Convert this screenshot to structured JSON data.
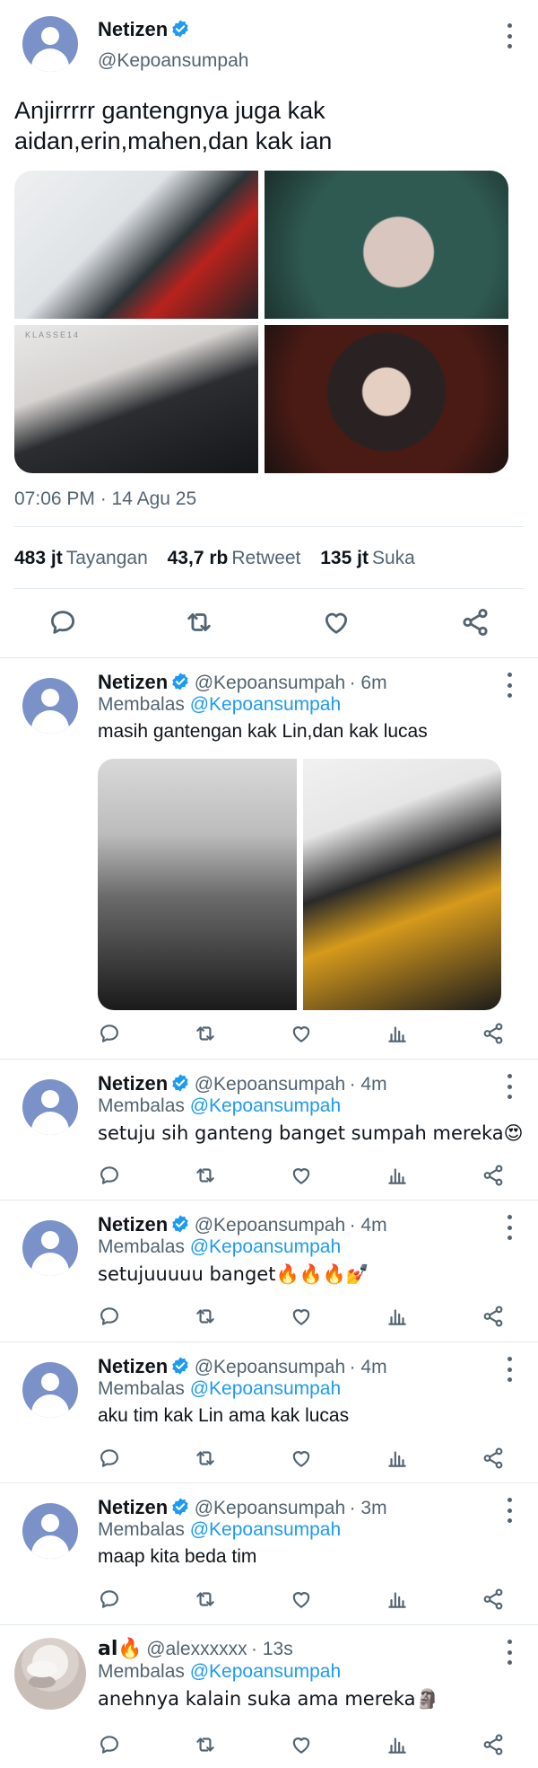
{
  "main_tweet": {
    "author": {
      "name": "Netizen",
      "handle": "@Kepoansumpah",
      "verified": true
    },
    "text": "Anjirrrrr gantengnya juga kak aidan,erin,mahen,dan kak ian",
    "media_count": 4,
    "media_caption": "KLASSE14",
    "timestamp": "07:06 PM · 14 Agu 25",
    "stats": {
      "views_value": "483 jt",
      "views_label": "Tayangan",
      "retweets_value": "43,7 rb",
      "retweets_label": "Retweet",
      "likes_value": "135 jt",
      "likes_label": "Suka"
    },
    "actions": [
      "reply-icon",
      "retweet-icon",
      "like-icon",
      "share-icon"
    ]
  },
  "replies": [
    {
      "name": "Netizen",
      "handle": "@Kepoansumpah",
      "time": "· 6m",
      "verified": true,
      "replying_prefix": "Membalas",
      "replying_to": "@Kepoansumpah",
      "text": "masih gantengan kak Lin,dan kak lucas",
      "has_media": true
    },
    {
      "name": "Netizen",
      "handle": "@Kepoansumpah",
      "time": "· 4m",
      "verified": true,
      "replying_prefix": "Membalas",
      "replying_to": "@Kepoansumpah",
      "text": "setuju sih ganteng banget sumpah mereka😍"
    },
    {
      "name": "Netizen",
      "handle": "@Kepoansumpah",
      "time": "· 4m",
      "verified": true,
      "replying_prefix": "Membalas",
      "replying_to": "@Kepoansumpah",
      "text": "setujuuuuu banget🔥🔥🔥💅"
    },
    {
      "name": "Netizen",
      "handle": "@Kepoansumpah",
      "time": "· 4m",
      "verified": true,
      "replying_prefix": "Membalas",
      "replying_to": "@Kepoansumpah",
      "text": "aku tim kak Lin ama kak lucas"
    },
    {
      "name": "Netizen",
      "handle": "@Kepoansumpah",
      "time": "· 3m",
      "verified": true,
      "replying_prefix": "Membalas",
      "replying_to": "@Kepoansumpah",
      "text": "maap kita beda tim"
    },
    {
      "name": "al🔥",
      "handle": "@alexxxxxx",
      "time": "· 13s",
      "verified": false,
      "replying_prefix": "Membalas",
      "replying_to": "@Kepoansumpah",
      "text": "anehnya kalain suka ama mereka🗿"
    }
  ],
  "reply_actions": [
    "reply-icon",
    "retweet-icon",
    "like-icon",
    "views-icon",
    "share-icon"
  ],
  "colors": {
    "accent": "#1d9bf0",
    "text": "#0f1419",
    "secondary": "#536471",
    "divider": "#e1e8ed"
  }
}
